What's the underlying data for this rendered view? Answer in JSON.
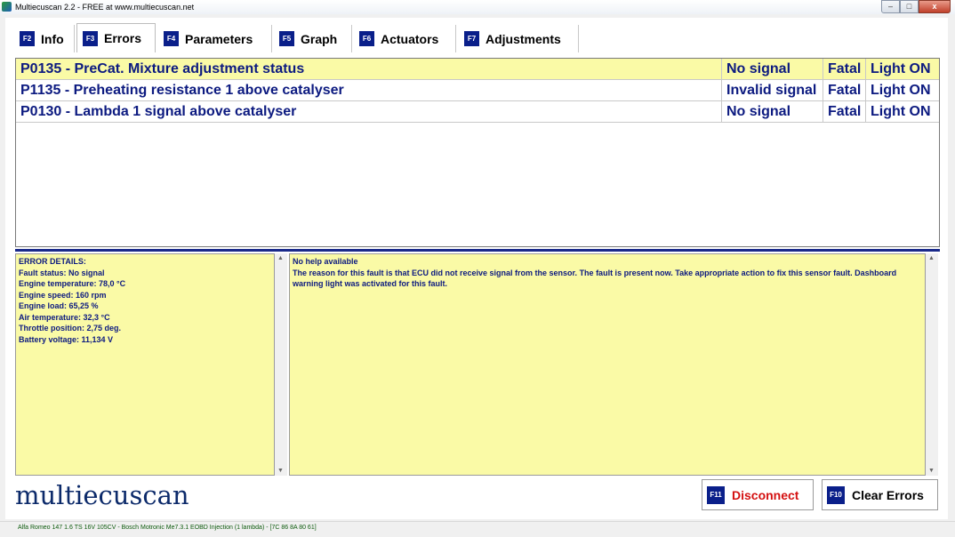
{
  "window": {
    "title": "Multiecuscan 2.2 - FREE at www.multiecuscan.net",
    "min_glyph": "–",
    "max_glyph": "□",
    "close_glyph": "x"
  },
  "tabs": [
    {
      "key": "F2",
      "label": "Info",
      "active": false
    },
    {
      "key": "F3",
      "label": "Errors",
      "active": true
    },
    {
      "key": "F4",
      "label": "Parameters",
      "active": false
    },
    {
      "key": "F5",
      "label": "Graph",
      "active": false
    },
    {
      "key": "F6",
      "label": "Actuators",
      "active": false
    },
    {
      "key": "F7",
      "label": "Adjustments",
      "active": false
    }
  ],
  "errors": [
    {
      "description": "P0135 - PreCat. Mixture adjustment status",
      "status": "No signal",
      "severity": "Fatal",
      "light": "Light ON"
    },
    {
      "description": "P1135 - Preheating resistance 1 above catalyser",
      "status": "Invalid signal",
      "severity": "Fatal",
      "light": "Light ON"
    },
    {
      "description": "P0130 - Lambda 1 signal above catalyser",
      "status": "No signal",
      "severity": "Fatal",
      "light": "Light ON"
    }
  ],
  "details": {
    "lines": [
      "ERROR DETAILS:",
      "Fault status: No signal",
      "Engine temperature: 78,0 °C",
      "Engine speed: 160 rpm",
      "Engine load: 65,25 %",
      "Air temperature: 32,3 °C",
      "Throttle position: 2,75 deg.",
      "Battery voltage: 11,134 V"
    ]
  },
  "help": {
    "title": "No help available",
    "text": "The reason for this fault is that ECU did not receive signal from the sensor. The fault is present now. Take appropriate action to fix this sensor fault. Dashboard warning light was activated for this fault."
  },
  "logo": "multiecuscan",
  "buttons": {
    "disconnect_key": "F11",
    "disconnect_label": "Disconnect",
    "clear_key": "F10",
    "clear_label": "Clear Errors"
  },
  "status": "Alfa Romeo 147 1.6 TS 16V 105CV - Bosch Motronic Me7.3.1 EOBD Injection (1 lambda) - [7C 86 8A 80 61]",
  "colors": {
    "selected_row": "#fafaa6",
    "error_text": "#0c1a80",
    "fkey_bg": "#0a1f8a",
    "disconnect_text": "#d41010"
  }
}
